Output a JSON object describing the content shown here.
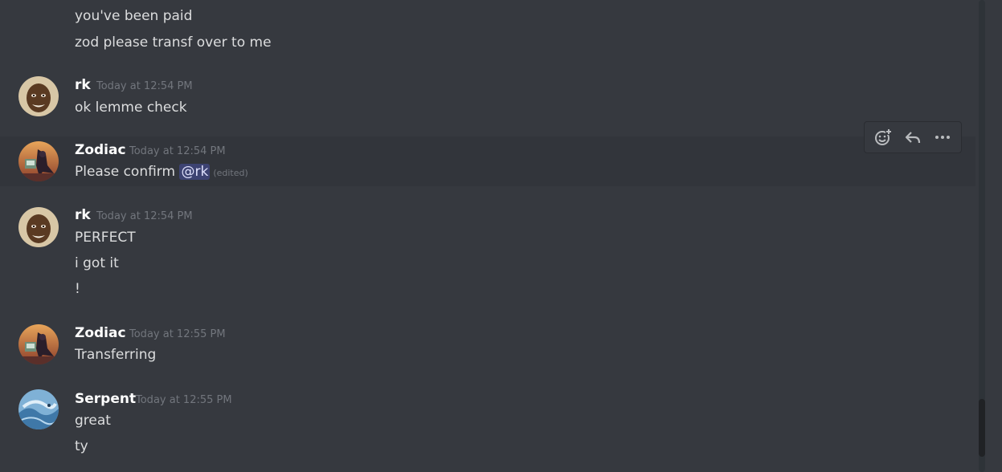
{
  "colors": {
    "background": "#36393f",
    "hover_row": "#32353b",
    "text": "#dcddde",
    "username": "#ffffff",
    "timestamp": "#72767d",
    "mention_bg": "#4f5587"
  },
  "messages": {
    "prev_1": "you've been paid",
    "prev_2": "zod please transf over to me",
    "m1": {
      "username": "rk",
      "timestamp": "Today at 12:54 PM",
      "lines": [
        "ok lemme check"
      ]
    },
    "m2": {
      "username": "Zodiac",
      "timestamp": "Today at 12:54 PM",
      "text": "Please confirm",
      "mention": "@rk",
      "edited": "(edited)"
    },
    "m3": {
      "username": "rk",
      "timestamp": "Today at 12:54 PM",
      "lines": [
        "PERFECT",
        "i got it",
        "!"
      ]
    },
    "m4": {
      "username": "Zodiac",
      "timestamp": "Today at 12:55 PM",
      "lines": [
        "Transferring"
      ]
    },
    "m5": {
      "username": "Serpent",
      "timestamp": "Today at 12:55 PM",
      "lines": [
        "great",
        "ty"
      ]
    }
  },
  "toolbar": {
    "icons": [
      "add-reaction-icon",
      "reply-icon",
      "more-icon"
    ]
  }
}
